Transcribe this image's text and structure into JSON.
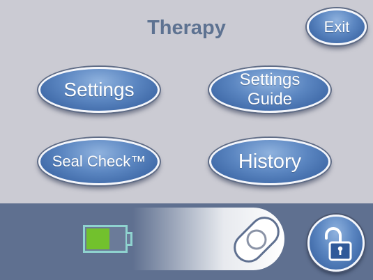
{
  "header": {
    "title": "Therapy",
    "exit_label": "Exit"
  },
  "menu": {
    "settings_label": "Settings",
    "settings_guide_line1": "Settings",
    "settings_guide_line2": "Guide",
    "seal_check_label": "Seal Check™",
    "history_label": "History"
  },
  "status_bar": {
    "battery_level": 0.62,
    "battery_fill_color": "#72c12d",
    "battery_outline_color": "#8fd3cf",
    "slider_icon": "mask-ring-icon",
    "lock_icon": "unlocked-padlock-icon"
  },
  "colors": {
    "background": "#cbcbd3",
    "title": "#5d7291",
    "button_blue": "#5b86c1",
    "bar": "#5f7090"
  }
}
